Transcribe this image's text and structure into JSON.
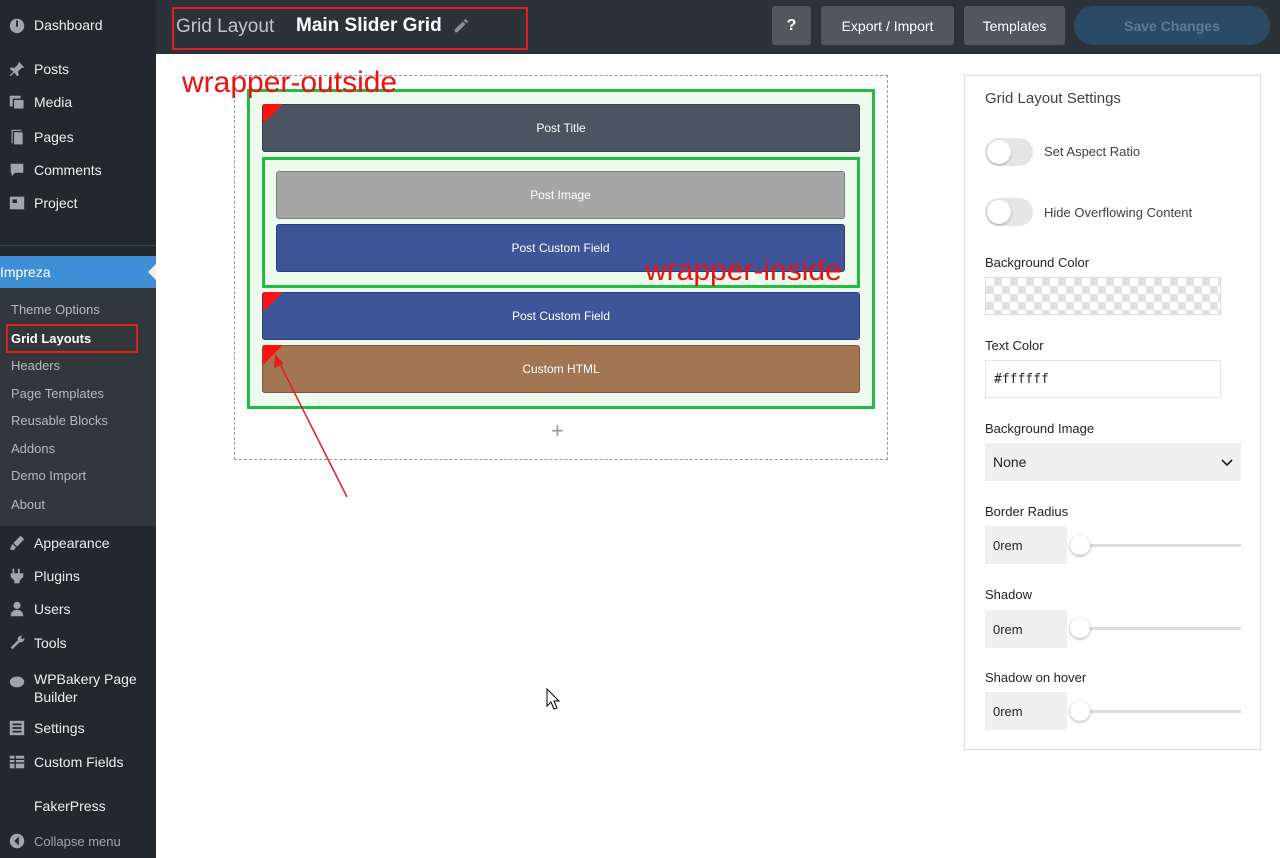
{
  "sidebar": {
    "items_top": [
      {
        "label": "Dashboard",
        "icon": "dashboard-icon"
      },
      {
        "label": "Posts",
        "icon": "pin-icon"
      },
      {
        "label": "Media",
        "icon": "media-icon"
      },
      {
        "label": "Pages",
        "icon": "pages-icon"
      },
      {
        "label": "Comments",
        "icon": "comment-icon"
      },
      {
        "label": "Project",
        "icon": "portfolio-icon"
      }
    ],
    "active_parent": {
      "label": "Impreza",
      "icon": "diamond-icon"
    },
    "submenu": [
      "Theme Options",
      "Grid Layouts",
      "Headers",
      "Page Templates",
      "Reusable Blocks",
      "Addons",
      "Demo Import",
      "About"
    ],
    "items_bottom": [
      {
        "label": "Appearance",
        "icon": "brush-icon"
      },
      {
        "label": "Plugins",
        "icon": "plugin-icon"
      },
      {
        "label": "Users",
        "icon": "users-icon"
      },
      {
        "label": "Tools",
        "icon": "wrench-icon"
      },
      {
        "label": "WPBakery Page Builder",
        "icon": "wpbakery-icon"
      },
      {
        "label": "Settings",
        "icon": "settings-icon"
      },
      {
        "label": "Custom Fields",
        "icon": "table-icon"
      },
      {
        "label": "FakerPress",
        "icon": ""
      },
      {
        "label": "Collapse menu",
        "icon": "collapse-icon"
      }
    ]
  },
  "topbar": {
    "label": "Grid Layout",
    "name": "Main Slider Grid",
    "help": "?",
    "export": "Export / Import",
    "templates": "Templates",
    "save": "Save Changes"
  },
  "canvas": {
    "post_title": "Post Title",
    "post_image": "Post Image",
    "post_custom_field_1": "Post Custom Field",
    "post_custom_field_2": "Post Custom Field",
    "custom_html": "Custom HTML",
    "add": "+"
  },
  "annotations": {
    "outside": "wrapper-outside",
    "inside": "wrapper-inside"
  },
  "settings": {
    "title": "Grid Layout Settings",
    "aspect_ratio": "Set Aspect Ratio",
    "hide_overflow": "Hide Overflowing Content",
    "bg_color_label": "Background Color",
    "text_color_label": "Text Color",
    "text_color_value": "#ffffff",
    "bg_image_label": "Background Image",
    "bg_image_value": "None",
    "border_radius_label": "Border Radius",
    "border_radius_value": "0rem",
    "shadow_label": "Shadow",
    "shadow_value": "0rem",
    "shadow_hover_label": "Shadow on hover",
    "shadow_hover_value": "0rem"
  }
}
